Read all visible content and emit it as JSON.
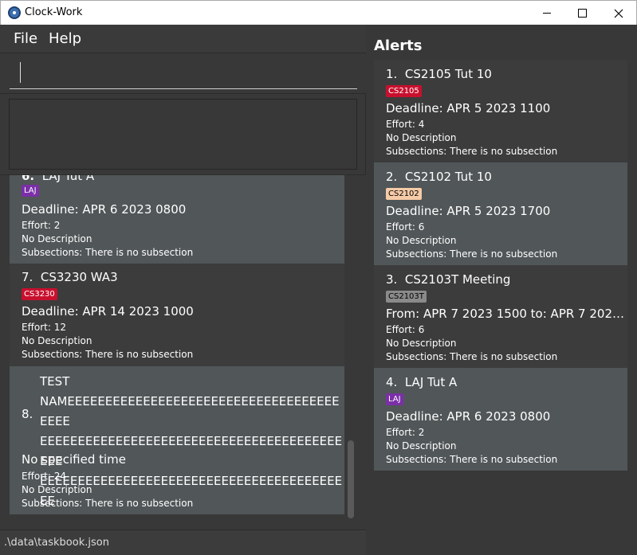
{
  "window": {
    "title": "Clock-Work",
    "minimize_icon": "minimize-icon",
    "maximize_icon": "maximize-icon",
    "close_icon": "close-icon"
  },
  "menu": {
    "file": "File",
    "help": "Help"
  },
  "command": {
    "value": "",
    "placeholder": ""
  },
  "result": {
    "text": ""
  },
  "tasks": [
    {
      "index": "6.",
      "name": "LAJ Tut A",
      "tag": "LAJ",
      "tag_color": "#7b2fa8",
      "tag_text_color": "#ffffff",
      "deadline": "Deadline: APR 6 2023 0800",
      "effort": "Effort: 2",
      "description": "No Description",
      "subsections": "Subsections: There is no subsection"
    },
    {
      "index": "7.",
      "name": "CS3230 WA3",
      "tag": "CS3230",
      "tag_color": "#c8102e",
      "tag_text_color": "#ffffff",
      "deadline": "Deadline: APR 14 2023 1000",
      "effort": "Effort: 12",
      "description": "No Description",
      "subsections": "Subsections: There is no subsection"
    },
    {
      "index": "8.",
      "name": "TEST\nNAMEEEEEEEEEEEEEEEEEEEEEEEEEEEEEEEEEEEEEEEE\nEEEEEEEEEEEEEEEEEEEEEEEEEEEEEEEEEEEEEEEEEEE\nEEEEEEEEEEEEEEEEEEEEEEEEEEEEEEEEEEEEEEEEEE",
      "deadline": "No specified time",
      "effort": "Effort: 24",
      "description": "No Description",
      "subsections": "Subsections: There is no subsection"
    }
  ],
  "status": {
    "path": ".\\data\\taskbook.json"
  },
  "alerts": {
    "title": "Alerts",
    "items": [
      {
        "index": "1.",
        "name": "CS2105 Tut 10",
        "tag": "CS2105",
        "tag_color": "#c8102e",
        "tag_text_color": "#ffffff",
        "deadline": "Deadline: APR 5 2023 1100",
        "effort": "Effort: 4",
        "description": "No Description",
        "subsections": "Subsections: There is no subsection"
      },
      {
        "index": "2.",
        "name": "CS2102 Tut 10",
        "tag": "CS2102",
        "tag_color": "#f5cba7",
        "tag_text_color": "#000000",
        "deadline": "Deadline: APR 5 2023 1700",
        "effort": "Effort: 6",
        "description": "No Description",
        "subsections": "Subsections: There is no subsection"
      },
      {
        "index": "3.",
        "name": "CS2103T Meeting",
        "tag": "CS2103T",
        "tag_color": "#8a8a8a",
        "tag_text_color": "#000000",
        "deadline": "From: APR 7 2023 1500 to: APR 7 2023 ...",
        "effort": "Effort: 6",
        "description": "No Description",
        "subsections": "Subsections: There is no subsection"
      },
      {
        "index": "4.",
        "name": "LAJ Tut A",
        "tag": "LAJ",
        "tag_color": "#7b2fa8",
        "tag_text_color": "#ffffff",
        "deadline": "Deadline: APR 6 2023 0800",
        "effort": "Effort: 2",
        "description": "No Description",
        "subsections": "Subsections: There is no subsection"
      }
    ]
  }
}
